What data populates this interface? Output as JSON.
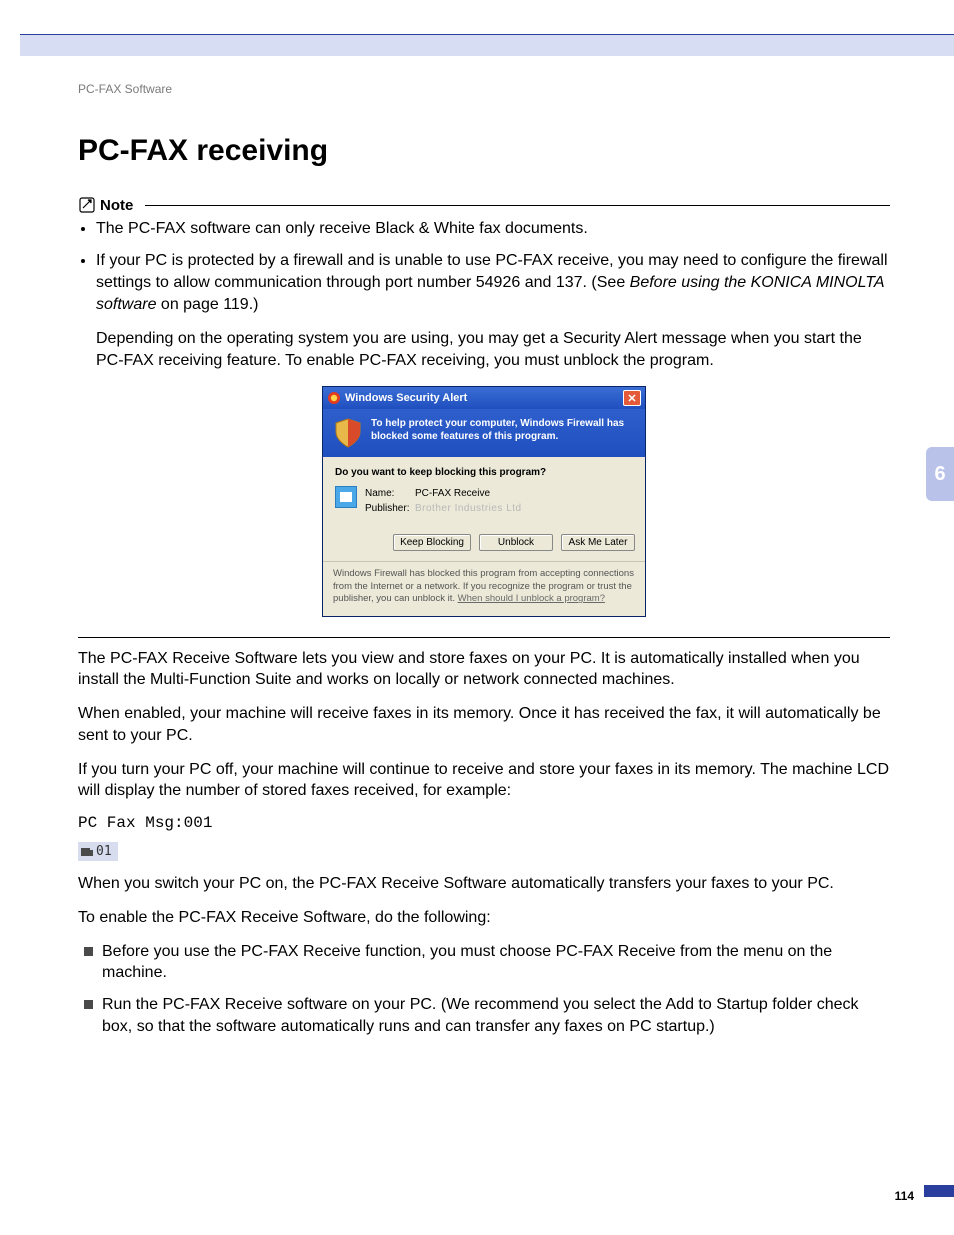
{
  "breadcrumb": "PC-FAX Software",
  "heading": "PC-FAX receiving",
  "note_label": "Note",
  "note_items": [
    "The PC-FAX software can only receive Black & White fax documents.",
    "If your PC is protected by a firewall and is unable to use PC-FAX receive, you may need to configure the firewall settings to allow communication through port number 54926 and 137. (See "
  ],
  "note_ref_italic": "Before using the KONICA MINOLTA software",
  "note_ref_tail": " on page 119.)",
  "note_sub": "Depending on the operating system you are using, you may get a Security Alert message when you start the PC-FAX receiving feature. To enable PC-FAX receiving, you must unblock the program.",
  "dialog": {
    "title": "Windows Security Alert",
    "warn": "To help protect your computer, Windows Firewall has blocked some features of this program.",
    "question": "Do you want to keep blocking this program?",
    "name_label": "Name:",
    "name_value": "PC-FAX Receive",
    "publisher_label": "Publisher:",
    "publisher_value": "Brother Industries Ltd",
    "btn_keep": "Keep Blocking",
    "btn_unblock": "Unblock",
    "btn_later": "Ask Me Later",
    "footer_text": "Windows Firewall has blocked this program from accepting connections from the Internet or a network. If you recognize the program or trust the publisher, you can unblock it. ",
    "footer_link": "When should I unblock a program?"
  },
  "body": {
    "p1": "The PC-FAX Receive Software lets you view and store faxes on your PC. It is automatically installed when you install the Multi-Function Suite and works on locally or network connected machines.",
    "p2": "When enabled, your machine will receive faxes in its memory. Once it has received the fax, it will automatically be sent to your PC.",
    "p3": "If you turn your PC off, your machine will continue to receive and store your faxes in its memory. The machine LCD will display the number of stored faxes received, for example:",
    "mono": "PC Fax Msg:001",
    "lcd": "01",
    "p4": "When you switch your PC on, the PC-FAX Receive Software automatically transfers your faxes to your PC.",
    "p5": "To enable the PC-FAX Receive Software, do the following:",
    "sq1": "Before you use the PC-FAX Receive function, you must choose PC-FAX Receive from the menu on the machine.",
    "sq2": "Run the PC-FAX Receive software on your PC. (We recommend you select the Add to Startup folder check box, so that the software automatically runs and can transfer any faxes on PC startup.)"
  },
  "side_tab": "6",
  "page_number": "114"
}
